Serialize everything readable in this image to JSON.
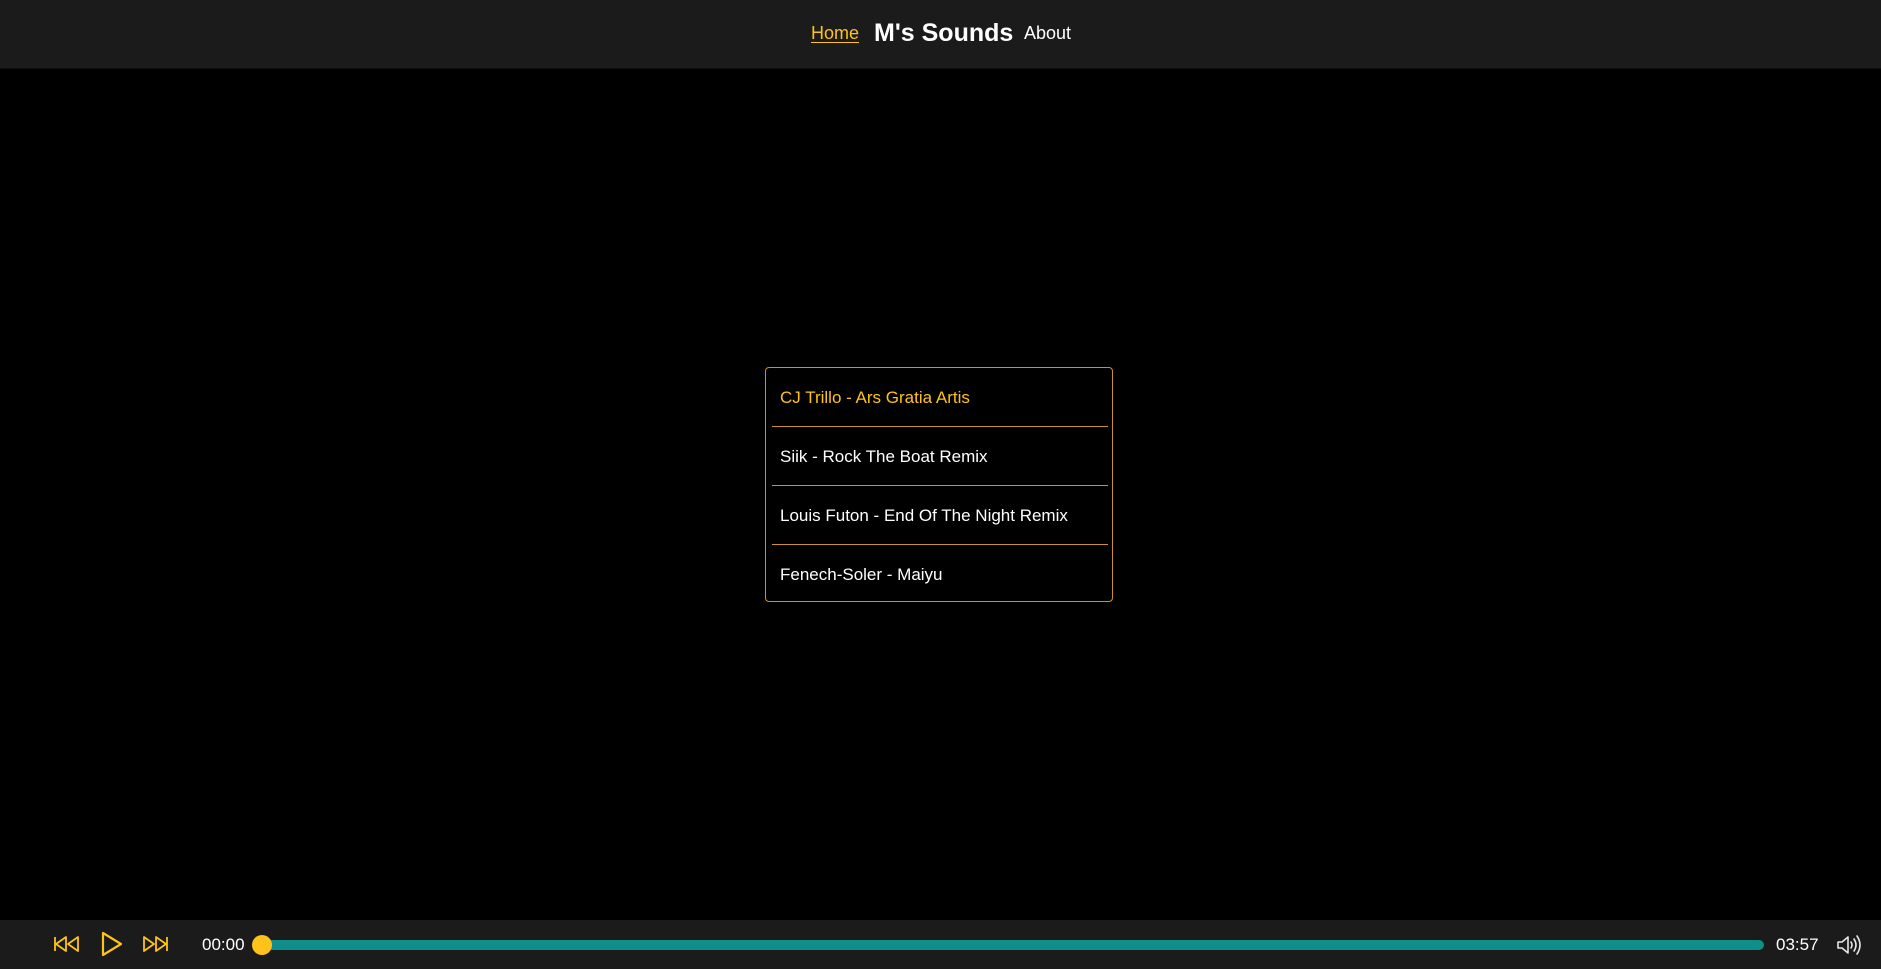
{
  "header": {
    "home_label": "Home",
    "brand": "M's Sounds",
    "about_label": "About"
  },
  "playlist": {
    "tracks": [
      {
        "label": "CJ Trillo - Ars Gratia Artis",
        "active": true
      },
      {
        "label": "Siik - Rock The Boat Remix",
        "active": false
      },
      {
        "label": "Louis Futon - End Of The Night Remix",
        "active": false
      },
      {
        "label": "Fenech-Soler - Maiyu",
        "active": false
      }
    ]
  },
  "player": {
    "current_time": "00:00",
    "total_time": "03:57",
    "progress": 0,
    "controls": {
      "previous_icon": "rewind-icon",
      "play_icon": "play-icon",
      "next_icon": "fast-forward-icon",
      "volume_icon": "volume-icon"
    }
  },
  "colors": {
    "accent": "#ffc21a",
    "track_bar": "#0f8e8a",
    "header_bg": "#1b1b1b",
    "page_bg": "#000000",
    "border": "#c9951c"
  }
}
